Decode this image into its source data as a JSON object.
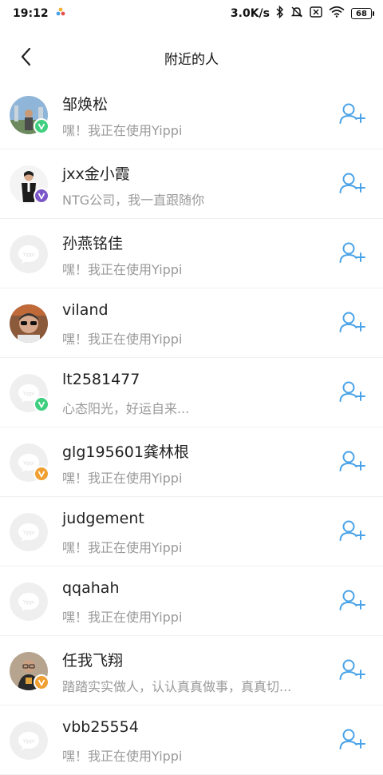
{
  "status_bar": {
    "time": "19:12",
    "network_speed": "3.0K/s",
    "battery": "68",
    "icons": [
      "notification-app-icon",
      "bluetooth-icon",
      "mute-icon",
      "sim-off-icon",
      "wifi-icon",
      "battery-icon"
    ]
  },
  "header": {
    "title": "附近的人",
    "back_icon": "chevron-left-icon"
  },
  "colors": {
    "accent": "#4aa3e8",
    "badge_green": "#3fcf7f",
    "badge_purple": "#7b56c9",
    "badge_orange": "#f0a032",
    "placeholder_bg": "#efefef"
  },
  "users": [
    {
      "name": "邹焕松",
      "subtitle": "嘿！我正在使用Yippi",
      "avatar": "photo-landscape",
      "badge": "green"
    },
    {
      "name": "jxx金小霞",
      "subtitle": "NTG公司，我一直跟随你",
      "avatar": "photo-person-suit",
      "badge": "purple"
    },
    {
      "name": "孙燕铭佳",
      "subtitle": "嘿！我正在使用Yippi",
      "avatar": "placeholder",
      "badge": null
    },
    {
      "name": "viland",
      "subtitle": "嘿！我正在使用Yippi",
      "avatar": "photo-man-sunglasses",
      "badge": null
    },
    {
      "name": "lt2581477",
      "subtitle": "心态阳光，好运自来...",
      "avatar": "placeholder",
      "badge": "green"
    },
    {
      "name": "glg195601龚林根",
      "subtitle": "嘿！我正在使用Yippi",
      "avatar": "placeholder",
      "badge": "orange"
    },
    {
      "name": "judgement",
      "subtitle": "嘿！我正在使用Yippi",
      "avatar": "placeholder",
      "badge": null
    },
    {
      "name": "qqahah",
      "subtitle": "嘿！我正在使用Yippi",
      "avatar": "placeholder",
      "badge": null
    },
    {
      "name": "任我飞翔",
      "subtitle": "踏踏实实做人，认认真真做事，真真切...",
      "avatar": "photo-man-glasses",
      "badge": "orange"
    },
    {
      "name": "vbb25554",
      "subtitle": "嘿！我正在使用Yippi",
      "avatar": "placeholder",
      "badge": null
    }
  ]
}
